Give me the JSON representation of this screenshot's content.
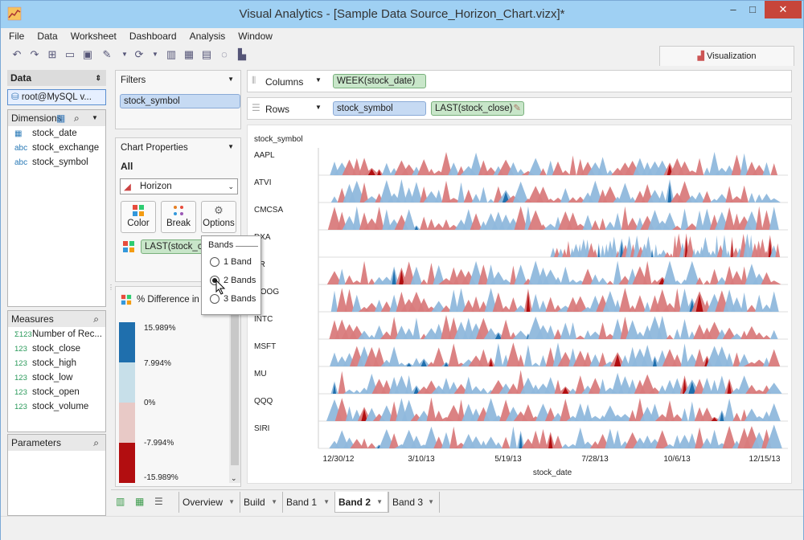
{
  "window": {
    "title": "Visual Analytics - [Sample Data Source_Horizon_Chart.vizx]*",
    "minimize": "–",
    "maximize": "□",
    "close": "✕"
  },
  "menu": [
    "File",
    "Data",
    "Worksheet",
    "Dashboard",
    "Analysis",
    "Window"
  ],
  "toolbar_icons": [
    "undo-icon",
    "redo-icon",
    "new-icon",
    "open-icon",
    "save-icon",
    "format-icon",
    "refresh-icon",
    "bar-chart-icon",
    "add-chart-icon",
    "column-icon",
    "lasso-icon",
    "sort-icon"
  ],
  "visualization_tab": "Visualization",
  "data_panel": {
    "header": "Data",
    "connection": "root@MySQL v...",
    "dimensions_header": "Dimensions",
    "dimensions": [
      {
        "type": "",
        "name": "stock_date"
      },
      {
        "type": "abc",
        "name": "stock_exchange"
      },
      {
        "type": "abc",
        "name": "stock_symbol"
      }
    ],
    "measures_header": "Measures",
    "measures": [
      {
        "type": "Σ123",
        "name": "Number of Rec..."
      },
      {
        "type": "123",
        "name": "stock_close"
      },
      {
        "type": "123",
        "name": "stock_high"
      },
      {
        "type": "123",
        "name": "stock_low"
      },
      {
        "type": "123",
        "name": "stock_open"
      },
      {
        "type": "123",
        "name": "stock_volume"
      }
    ],
    "parameters_header": "Parameters"
  },
  "filters": {
    "header": "Filters",
    "items": [
      "stock_symbol"
    ]
  },
  "chart_properties": {
    "header": "Chart Properties",
    "scope": "All",
    "chart_type": "Horizon",
    "buttons": [
      "Color",
      "Break",
      "Options"
    ],
    "color_field": "LAST(stock_clo..."
  },
  "legend": {
    "title": "% Difference in L...",
    "labels": [
      "15.989%",
      "7.994%",
      "0%",
      "-7.994%",
      "-15.989%"
    ],
    "colors": [
      "#1f6fad",
      "#c7dfe9",
      "#e8c9c6",
      "#b20e10"
    ]
  },
  "bands_popup": {
    "title": "Bands",
    "options": [
      "1 Band",
      "2 Bands",
      "3 Bands"
    ],
    "selected": "2 Bands"
  },
  "shelves": {
    "columns_label": "Columns",
    "columns_pill": "WEEK(stock_date)",
    "rows_label": "Rows",
    "rows_pills": [
      "stock_symbol",
      "LAST(stock_close)"
    ]
  },
  "chart_data": {
    "type": "area",
    "chart_style": "horizon",
    "row_header": "stock_symbol",
    "xlabel": "stock_date",
    "x_ticks": [
      "12/30/12",
      "3/10/13",
      "5/19/13",
      "7/28/13",
      "10/6/13",
      "12/15/13"
    ],
    "rows": [
      "AAPL",
      "ATVI",
      "CMCSA",
      "DXA",
      "ER",
      "GOOG",
      "INTC",
      "MSFT",
      "MU",
      "QQQ",
      "SIRI"
    ],
    "colors": {
      "positive_light": "#8fb8dc",
      "positive_dark": "#1f6fad",
      "negative_light": "#d97b7c",
      "negative_dark": "#b20e10"
    }
  },
  "sheet_tabs": [
    "Overview",
    "Build",
    "Band 1",
    "Band 2",
    "Band 3"
  ],
  "active_sheet": "Band 2"
}
